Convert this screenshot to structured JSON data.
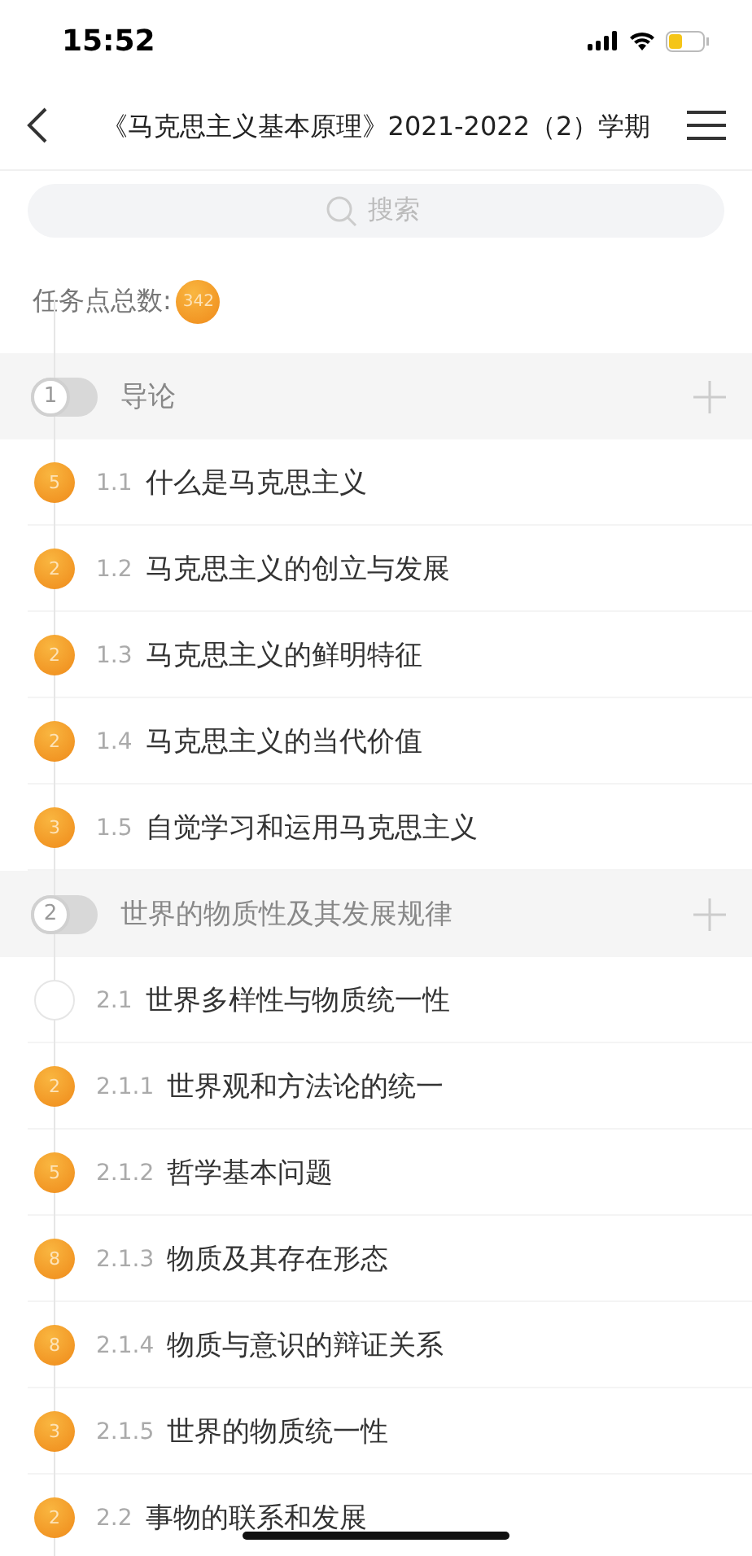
{
  "status_bar": {
    "time": "15:52"
  },
  "header": {
    "title": "《马克思主义基本原理》2021-2022（2）学期"
  },
  "search": {
    "placeholder": "搜索"
  },
  "task_total": {
    "label": "任务点总数:",
    "count": "342"
  },
  "chapters": [
    {
      "number": "1",
      "title": "导论",
      "expanded": false,
      "items": [
        {
          "index": "1.1",
          "title": "什么是马克思主义",
          "badge": "5"
        },
        {
          "index": "1.2",
          "title": "马克思主义的创立与发展",
          "badge": "2"
        },
        {
          "index": "1.3",
          "title": "马克思主义的鲜明特征",
          "badge": "2"
        },
        {
          "index": "1.4",
          "title": "马克思主义的当代价值",
          "badge": "2"
        },
        {
          "index": "1.5",
          "title": "自觉学习和运用马克思主义",
          "badge": "3"
        }
      ]
    },
    {
      "number": "2",
      "title": "世界的物质性及其发展规律",
      "expanded": false,
      "items": [
        {
          "index": "2.1",
          "title": "世界多样性与物质统一性"
        },
        {
          "index": "2.1.1",
          "title": "世界观和方法论的统一",
          "badge": "2"
        },
        {
          "index": "2.1.2",
          "title": "哲学基本问题",
          "badge": "5"
        },
        {
          "index": "2.1.3",
          "title": "物质及其存在形态",
          "badge": "8"
        },
        {
          "index": "2.1.4",
          "title": "物质与意识的辩证关系",
          "badge": "8"
        },
        {
          "index": "2.1.5",
          "title": "世界的物质统一性",
          "badge": "3"
        },
        {
          "index": "2.2",
          "title": "事物的联系和发展",
          "badge": "2"
        }
      ]
    }
  ]
}
